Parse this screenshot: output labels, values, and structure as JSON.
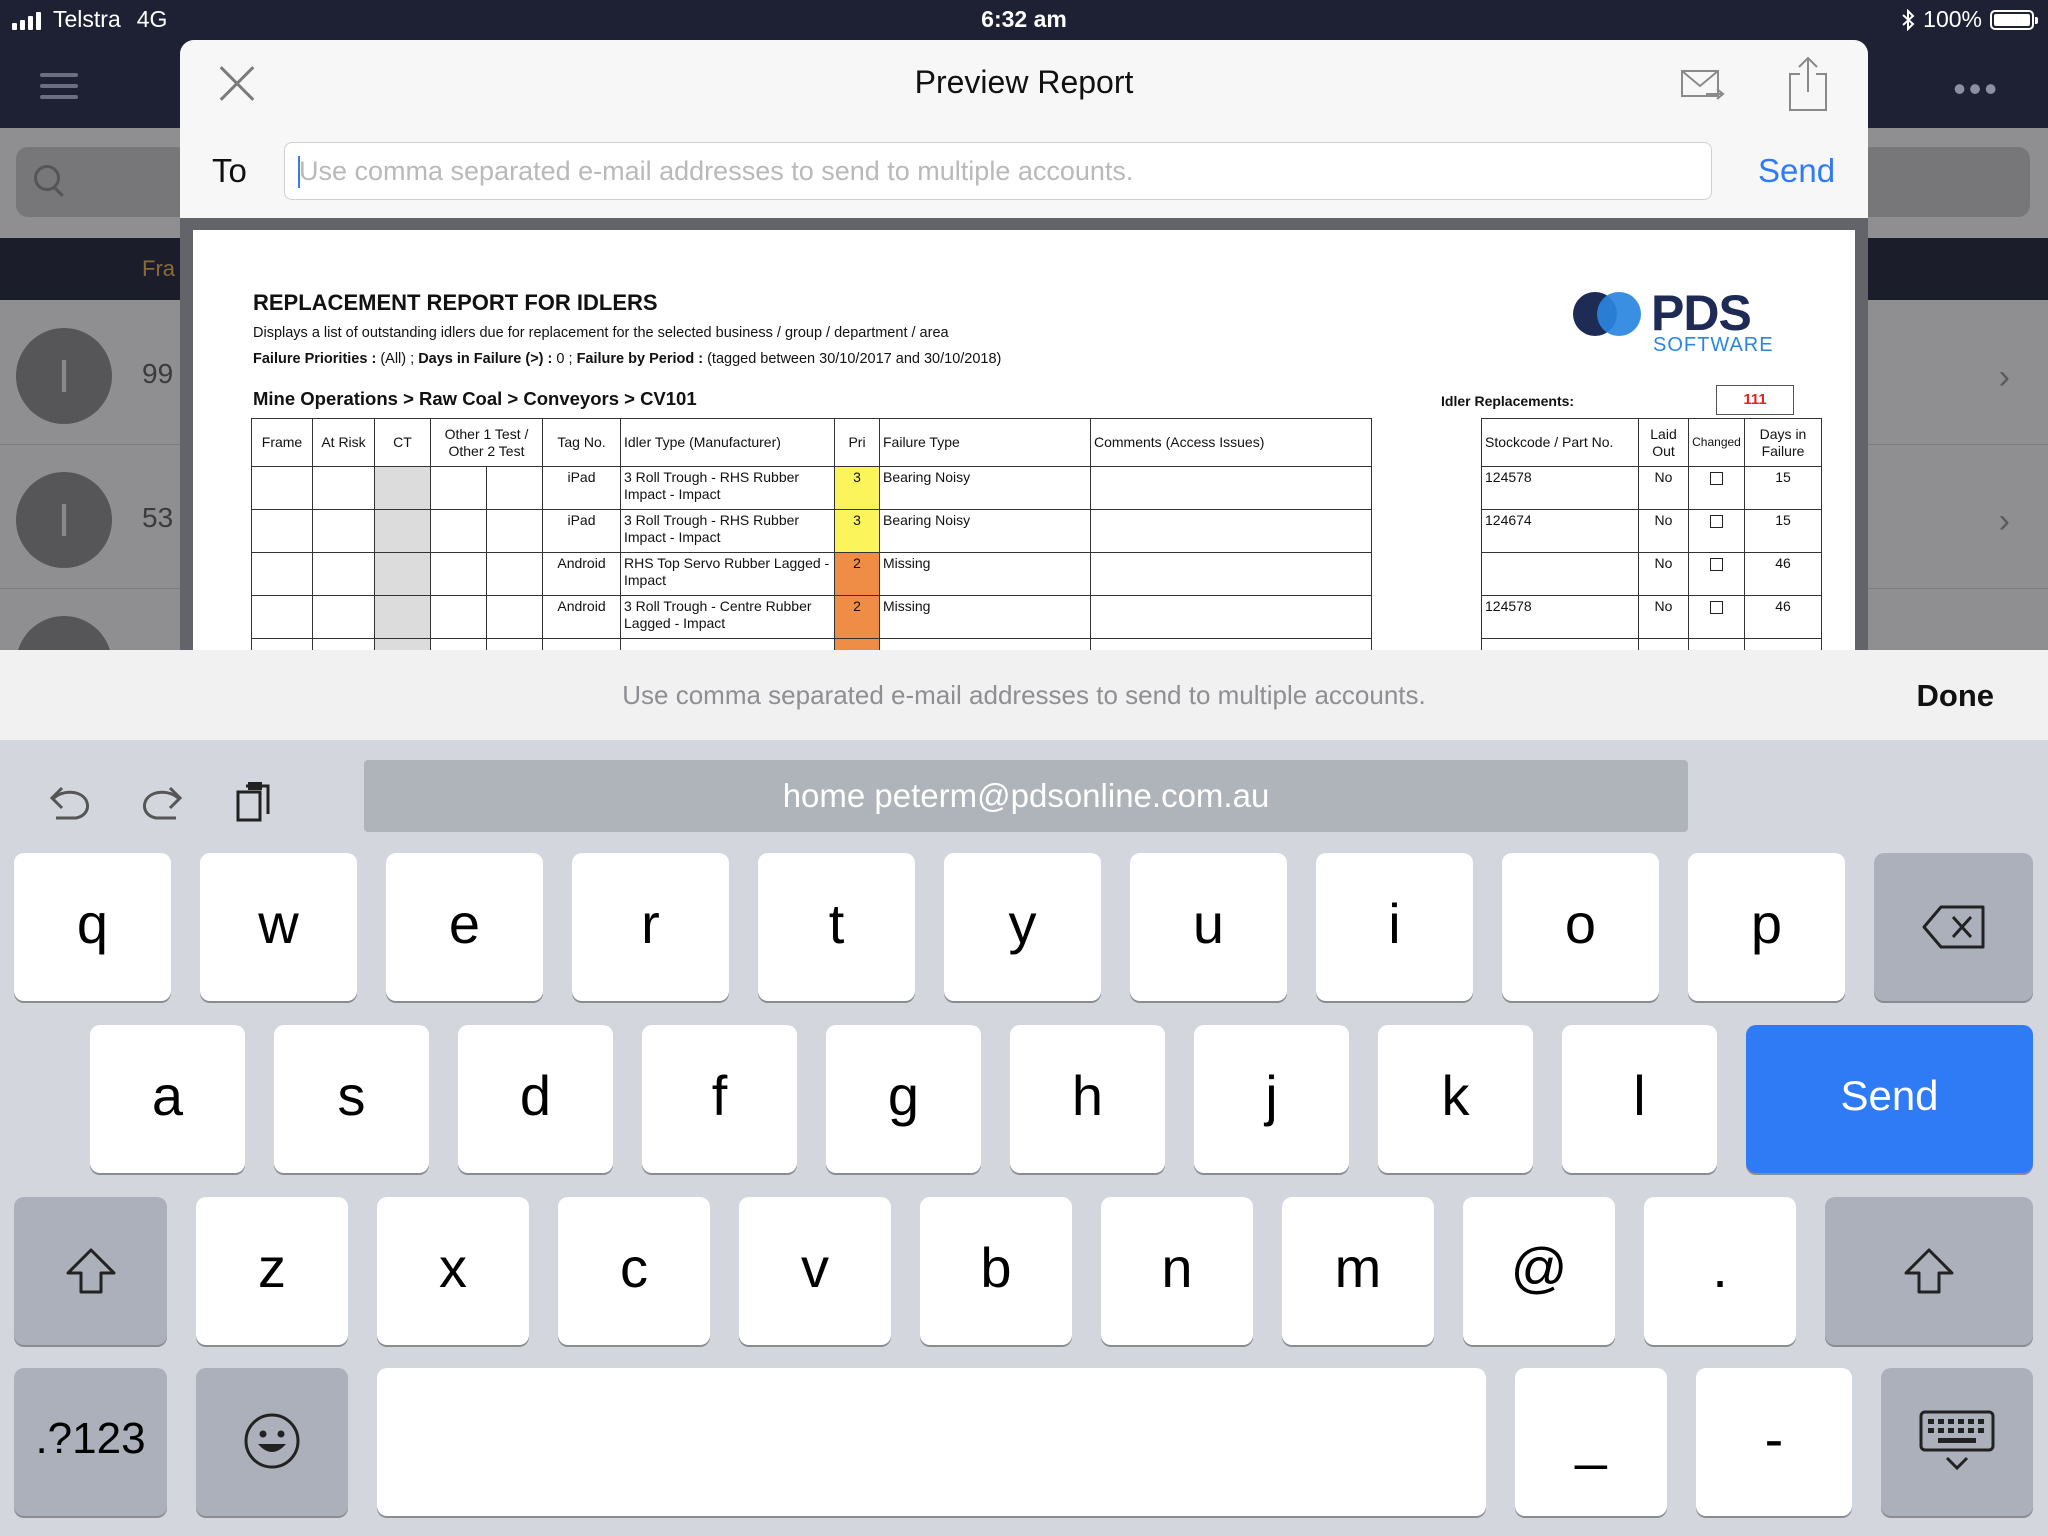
{
  "status_bar": {
    "carrier": "Telstra",
    "network": "4G",
    "time": "6:32 am",
    "battery": "100%"
  },
  "background_app": {
    "band_text": "Fra",
    "rows": [
      {
        "avatar": "I",
        "value": "99"
      },
      {
        "avatar": "I",
        "value": "53"
      }
    ]
  },
  "modal": {
    "title": "Preview Report",
    "to_label": "To",
    "to_placeholder": "Use comma separated e-mail addresses to send to multiple accounts.",
    "send_label": "Send"
  },
  "report": {
    "title": "REPLACEMENT REPORT FOR IDLERS",
    "description": "Displays a list of outstanding idlers due for replacement for the selected business / group / department  / area",
    "filter_priorities_label": "Failure Priorities :",
    "filter_priorities_value": "(All) ;",
    "filter_days_label": "Days in Failure (>) :",
    "filter_days_value": "0 ;",
    "filter_period_label": "Failure by Period :",
    "filter_period_value": "(tagged between 30/10/2017 and 30/10/2018)",
    "logo_word": "PDS",
    "logo_sub": "SOFTWARE",
    "path": "Mine Operations > Raw Coal > Conveyors > CV101",
    "idler_replacements_label": "Idler Replacements:",
    "idler_replacements_value": "111",
    "columns_left": [
      "Frame",
      "At Risk",
      "CT",
      "Other 1 Test / Other 2 Test",
      "Tag No.",
      "Idler Type (Manufacturer)",
      "Pri",
      "Failure Type",
      "Comments (Access Issues)"
    ],
    "columns_right": [
      "Stockcode / Part No.",
      "Laid Out",
      "Changed",
      "Days in Failure"
    ],
    "rows": [
      {
        "tag": "iPad",
        "idler_type": "3 Roll Trough - RHS Rubber Impact - Impact",
        "pri": "3",
        "failure": "Bearing Noisy",
        "comments": "",
        "stockcode": "124578",
        "laid_out": "No",
        "changed": false,
        "days": "15"
      },
      {
        "tag": "iPad",
        "idler_type": "3 Roll Trough - RHS Rubber Impact - Impact",
        "pri": "3",
        "failure": "Bearing Noisy",
        "comments": "",
        "stockcode": "124674",
        "laid_out": "No",
        "changed": false,
        "days": "15"
      },
      {
        "tag": "Android",
        "idler_type": "RHS Top Servo Rubber Lagged - Impact",
        "pri": "2",
        "failure": "Missing",
        "comments": "",
        "stockcode": "",
        "laid_out": "No",
        "changed": false,
        "days": "46"
      },
      {
        "tag": "Android",
        "idler_type": "3 Roll Trough - Centre Rubber Lagged - Impact",
        "pri": "2",
        "failure": "Missing",
        "comments": "",
        "stockcode": "124578",
        "laid_out": "No",
        "changed": false,
        "days": "46"
      }
    ],
    "colors": {
      "pri_3": "#fbf45a",
      "pri_2": "#ef8c46",
      "count": "#e0241b"
    }
  },
  "keyboard": {
    "prompt": "Use comma separated e-mail addresses to send to multiple accounts.",
    "done_label": "Done",
    "suggestion": "home  peterm@pdsonline.com.au",
    "row1": [
      "q",
      "w",
      "e",
      "r",
      "t",
      "y",
      "u",
      "i",
      "o",
      "p"
    ],
    "row2": [
      "a",
      "s",
      "d",
      "f",
      "g",
      "h",
      "j",
      "k",
      "l"
    ],
    "row3": [
      "z",
      "x",
      "c",
      "v",
      "b",
      "n",
      "m",
      "@",
      "."
    ],
    "send_label": "Send",
    "numbers_label": ".?123",
    "underscore_label": "_",
    "dash_label": "-",
    "accent_color": "#2f7bf5"
  }
}
